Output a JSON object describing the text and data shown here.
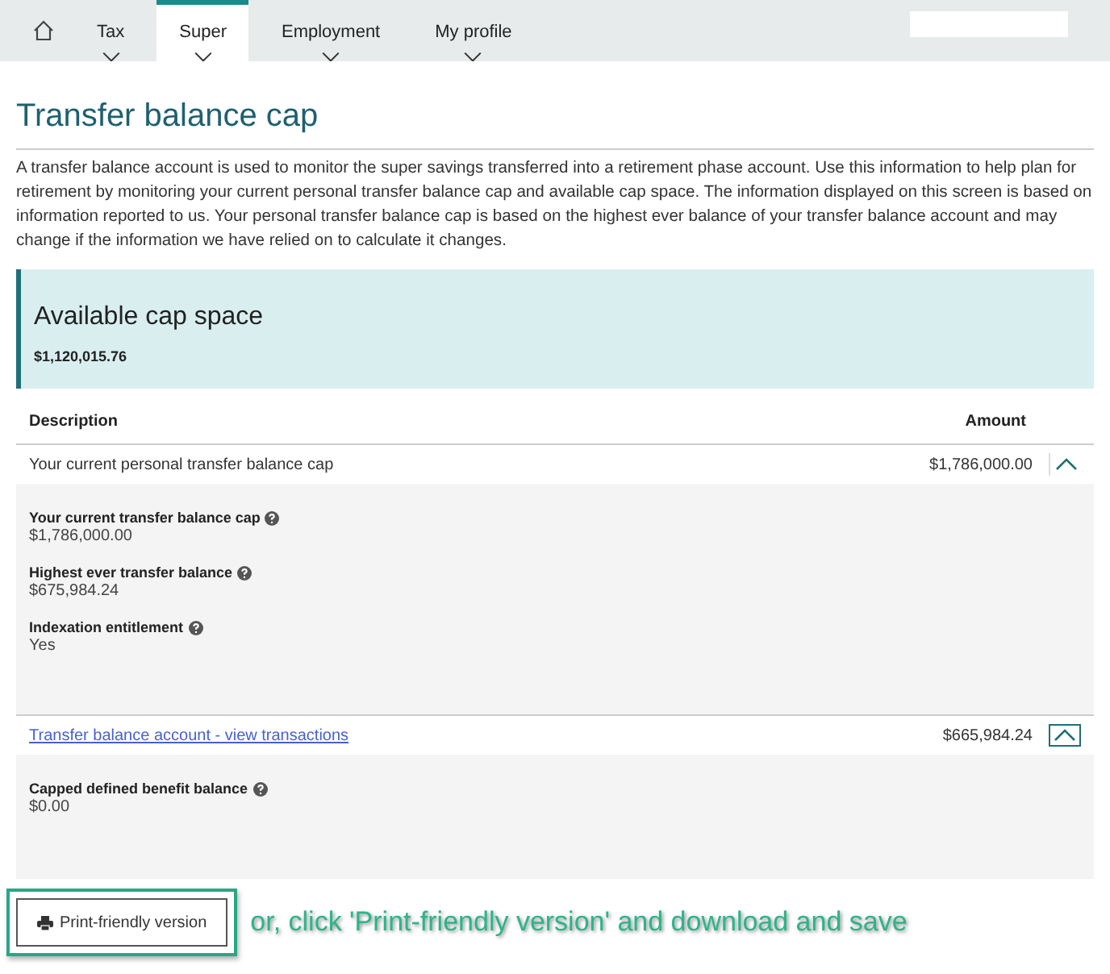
{
  "nav": {
    "tabs": [
      {
        "label": "Tax",
        "selected": false
      },
      {
        "label": "Super",
        "selected": true
      },
      {
        "label": "Employment",
        "selected": false
      },
      {
        "label": "My profile",
        "selected": false
      }
    ]
  },
  "title": "Transfer balance cap",
  "intro": "A transfer balance account is used to monitor the super savings transferred into a retirement phase account. Use this information to help plan for retirement by monitoring your current personal transfer balance cap and available cap space. The information displayed on this screen is based on information reported to us. Your personal transfer balance cap is based on the highest ever balance of your transfer balance account and may change if the information we have relied on to calculate it changes.",
  "summary": {
    "heading": "Available cap space",
    "amount": "$1,120,015.76"
  },
  "table": {
    "columns": [
      "Description",
      "Amount"
    ],
    "rows": [
      {
        "kind": "text",
        "description": "Your current personal transfer balance cap",
        "amount": "$1,786,000.00",
        "expanded": true,
        "details": [
          {
            "label": "Your current transfer balance cap",
            "value": "$1,786,000.00"
          },
          {
            "label": "Highest ever transfer balance",
            "value": "$675,984.24"
          },
          {
            "label": "Indexation entitlement",
            "value": "Yes"
          }
        ]
      },
      {
        "kind": "link",
        "description": "Transfer balance account - view transactions",
        "amount": "$665,984.24",
        "expanded": true,
        "details": [
          {
            "label": "Capped defined benefit balance",
            "value": "$0.00"
          }
        ]
      }
    ]
  },
  "print_button": "Print-friendly version",
  "annotation": "or, click 'Print-friendly version' and download and save"
}
